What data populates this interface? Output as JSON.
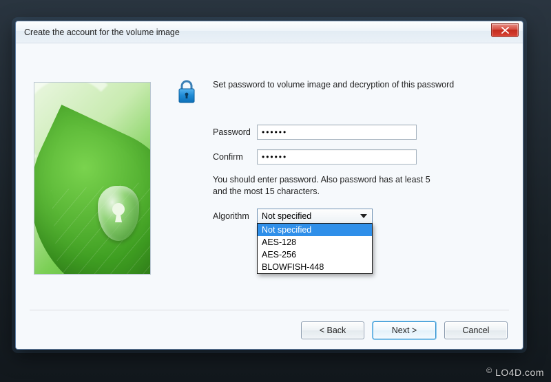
{
  "window": {
    "title": "Create the account for the volume image",
    "close_icon_name": "close-icon"
  },
  "intro": {
    "text": "Set password to volume image and decryption of this password"
  },
  "form": {
    "password": {
      "label": "Password",
      "value": "••••••"
    },
    "confirm": {
      "label": "Confirm",
      "value": "••••••"
    },
    "hint": "You should enter password. Also password has at least 5 and the most 15 characters.",
    "algorithm": {
      "label": "Algorithm",
      "selected": "Not specified",
      "options": [
        "Not specified",
        "AES-128",
        "AES-256",
        "BLOWFISH-448"
      ]
    }
  },
  "buttons": {
    "back": "< Back",
    "next": "Next >",
    "cancel": "Cancel"
  },
  "watermark": "LO4D.com"
}
